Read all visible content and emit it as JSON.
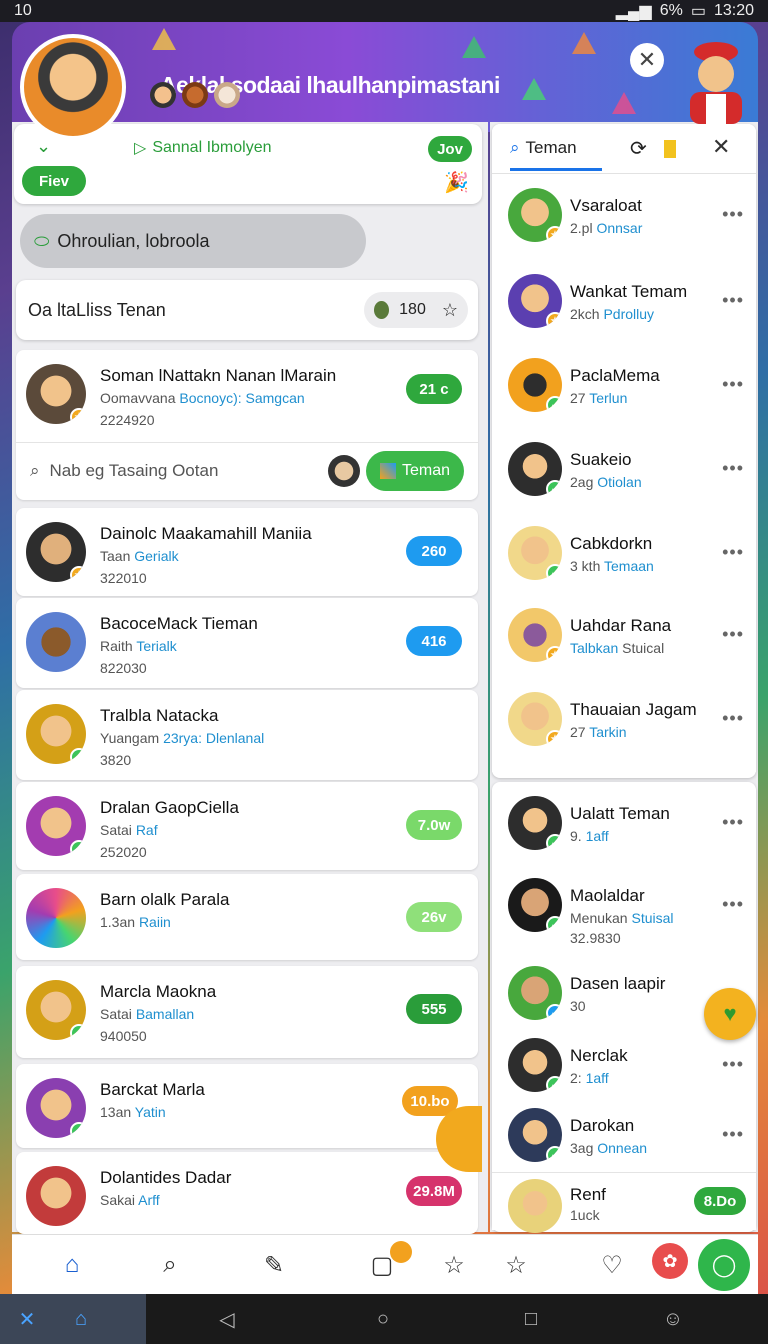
{
  "status": {
    "time_left": "10",
    "battery": "6%",
    "time_right": "13:20"
  },
  "header": {
    "title": "Aeklal sodaai lhaulhanpimastani"
  },
  "top": {
    "link_label": "Sannal Ibmolyen",
    "jov_label": "Jov",
    "fiev_label": "Fiev"
  },
  "chip": {
    "label": "Ohroulian, lobroola"
  },
  "section": {
    "title": "Oa ltaLliss Tenan",
    "count": "180"
  },
  "featured": {
    "name": "Soman lNattakn Nanan lMarain",
    "sub": "Oomavvana",
    "sub_blue": "Bocnoyc): Samgcan",
    "num": "2224920",
    "score": "21 с"
  },
  "search": {
    "placeholder": "Nab eg Tasaing Ootan",
    "button_label": "Teman"
  },
  "rows": [
    {
      "name": "Dainolc Maakamahill Maniia",
      "sub": "Taan",
      "sub_blue": "Gerialk",
      "num": "322010",
      "score": "260",
      "color": "#1e9bf0"
    },
    {
      "name": "BacoceMack Tieman",
      "sub": "Raith",
      "sub_blue": "Terialk",
      "num": "822030",
      "score": "416",
      "color": "#1e9bf0"
    },
    {
      "name": "Tralbla Natacka",
      "sub": "Yuangam",
      "sub_blue": "23rya: Dlenlanal",
      "num": "3820",
      "score": "",
      "color": ""
    },
    {
      "name": "Dralan GaopCiella",
      "sub": "Satai",
      "sub_blue": "Raf",
      "num": "252020",
      "score": "7.0w",
      "color": "#7ad96a"
    },
    {
      "name": "Barn olalk Parala",
      "sub": "1.3an",
      "sub_blue": "Raiin",
      "num": "",
      "score": "26v",
      "color": "#8fe07a"
    },
    {
      "name": "Marcla Maokna",
      "sub": "Satai",
      "sub_blue": "Bamallan",
      "num": "940050",
      "score": "555",
      "color": "#2a9d3a"
    },
    {
      "name": "Barckat Marla",
      "sub": "13an",
      "sub_blue": "Yatin",
      "num": "",
      "score": "10.bo",
      "color": "#f2a11e"
    },
    {
      "name": "Dolantides Dadar",
      "sub": "Sakai",
      "sub_blue": "Arff",
      "num": "",
      "score": "29.8M",
      "color": "#d6336c"
    }
  ],
  "right": {
    "tab_label": "Teman",
    "friends": [
      {
        "name": "Vsaraloat",
        "sub": "2.pl",
        "sub_blue": "Onnsar"
      },
      {
        "name": "Wankat Temam",
        "sub": "2kch",
        "sub_blue": "Pdrolluy"
      },
      {
        "name": "PaclaMema",
        "sub": "27",
        "sub_blue": "Terlun"
      },
      {
        "name": "Suakeio",
        "sub": "2ag",
        "sub_blue": "Otiolan"
      },
      {
        "name": "Cabkdorkn",
        "sub": "3 kth",
        "sub_blue": "Temaan"
      },
      {
        "name": "Uahdar Rana",
        "sub": "Stuical",
        "sub_blue": "Talbkan"
      },
      {
        "name": "Thauaian Jagam",
        "sub": "27",
        "sub_blue": "Tarkin"
      }
    ],
    "others": [
      {
        "name": "Ualatt Teman",
        "sub": "9.",
        "sub_blue": "1aff"
      },
      {
        "name": "Maolaldar",
        "sub": "Menukan",
        "sub_blue": "Stuisal",
        "num": "32.9830"
      },
      {
        "name": "Dasen laapir",
        "sub": "30",
        "sub_blue": ""
      },
      {
        "name": "Nerclak",
        "sub": "2:",
        "sub_blue": "1aff"
      },
      {
        "name": "Darokan",
        "sub": "3ag",
        "sub_blue": "Onnean"
      },
      {
        "name": "Renf",
        "sub": "1uck",
        "sub_blue": "",
        "score": "8.Do"
      }
    ]
  },
  "icons": {
    "home": "home-icon",
    "search": "search-icon",
    "compose": "compose-icon",
    "notes": "notes-icon",
    "star": "star-icon",
    "heart": "heart-icon",
    "chat": "chat-icon"
  }
}
